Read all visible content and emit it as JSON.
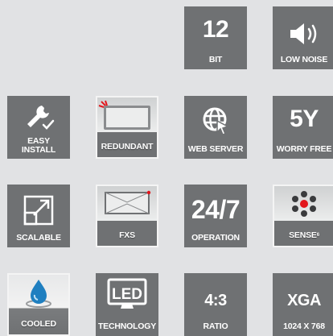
{
  "tiles": {
    "bit": {
      "big": "12",
      "label": "BIT"
    },
    "low_noise": {
      "label": "LOW NOISE"
    },
    "easy_install": {
      "label_line1": "EASY",
      "label_line2": "INSTALL"
    },
    "redundant": {
      "label": "REDUNDANT"
    },
    "web_server": {
      "label": "WEB SERVER"
    },
    "worry_free": {
      "big": "5Y",
      "label": "WORRY FREE"
    },
    "scalable": {
      "label": "SCALABLE"
    },
    "fxs": {
      "label": "FXS"
    },
    "operation": {
      "big": "24/7",
      "label": "OPERATION"
    },
    "sense": {
      "label": "SENSE",
      "label_sup": "6"
    },
    "cooled": {
      "label": "COOLED"
    },
    "technology": {
      "icon_text": "LED",
      "label": "TECHNOLOGY"
    },
    "ratio": {
      "big": "4:3",
      "label": "RATIO"
    },
    "xga": {
      "big": "XGA",
      "label": "1024 X 768"
    }
  },
  "colors": {
    "background": "#e1e2e4",
    "tile": "#6f7173",
    "tile_border": "#f4f4f4",
    "accent_red": "#e3161c",
    "water_blue": "#1f7fc0"
  }
}
